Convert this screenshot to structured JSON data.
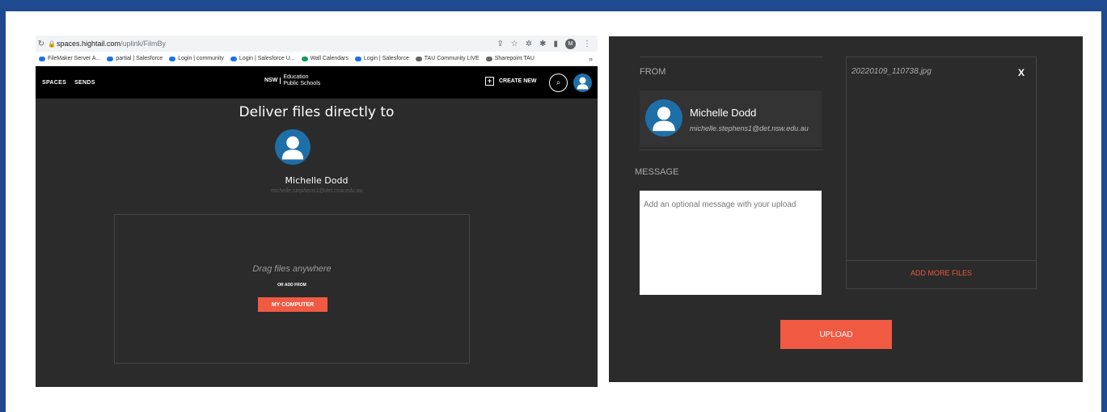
{
  "browser": {
    "url_host": "spaces.hightail.com",
    "url_path": "/uplink/FilmBy",
    "profile_initial": "M",
    "bookmarks": [
      "FileMaker Server A...",
      "partial | Salesforce",
      "Login | community",
      "Login | Salesforce U...",
      "Wall Calendars",
      "Login | Salesforce",
      "TAU Community LIVE",
      "Sharepoint TAU"
    ],
    "more": "»"
  },
  "app": {
    "nav": [
      "SPACES",
      "SENDS"
    ],
    "logo_top": "NSW",
    "logo_edu": "Education",
    "logo_sub": "Public Schools",
    "create_label": "CREATE NEW"
  },
  "uplink": {
    "headline": "Deliver files directly to",
    "name": "Michelle Dodd",
    "email": "michelle.stephens1@det.nsw.edu.au",
    "drag_text": "Drag files anywhere",
    "or_add": "OR ADD FROM",
    "my_computer": "MY COMPUTER"
  },
  "upload_form": {
    "from_label": "FROM",
    "name": "Michelle Dodd",
    "email": "michelle.stephens1@det.nsw.edu.au",
    "message_label": "MESSAGE",
    "message_placeholder": "Add an optional message with your upload",
    "file_name": "20220109_110738.jpg",
    "remove": "X",
    "add_more": "ADD MORE FILES",
    "upload": "UPLOAD"
  },
  "colors": {
    "frame": "#1f4a8f",
    "panel": "#2b2b2b",
    "accent": "#f05a43",
    "avatar": "#1e6fa8"
  }
}
